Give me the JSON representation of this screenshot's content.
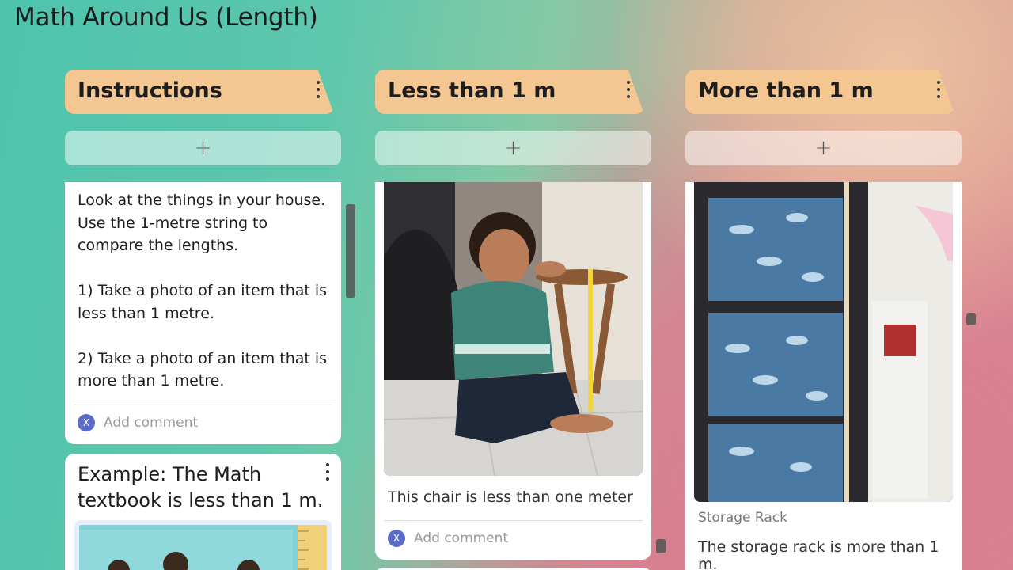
{
  "board": {
    "title": "Math Around Us (Length)"
  },
  "columns": [
    {
      "title": "Instructions",
      "add_label": "+",
      "card1": {
        "text": "Look at the things in your house.\nUse the 1-metre string to compare the lengths.\n\n1)  Take a photo of an item that is less than 1 metre.\n\n2)  Take a photo of an item that is more than 1 metre.",
        "avatar_initial": "X",
        "comment_placeholder": "Add comment"
      },
      "card2": {
        "heading": "Example: The Math textbook is less than 1 m."
      }
    },
    {
      "title": "Less than 1 m",
      "add_label": "+",
      "post": {
        "image_desc": "Child measuring wooden stool with tape measure",
        "caption": "This chair is less than one meter",
        "avatar_initial": "X",
        "comment_placeholder": "Add comment"
      }
    },
    {
      "title": "More than 1 m",
      "add_label": "+",
      "post": {
        "image_desc": "Storage rack with blue dinosaur boxes",
        "subject": "Storage Rack",
        "caption": "The storage rack is more than 1 m."
      }
    }
  ],
  "icons": {
    "menu": "kebab-menu-icon",
    "add": "plus-icon"
  },
  "colors": {
    "column_header": "#f4c792",
    "avatar": "#5a6bc8"
  }
}
